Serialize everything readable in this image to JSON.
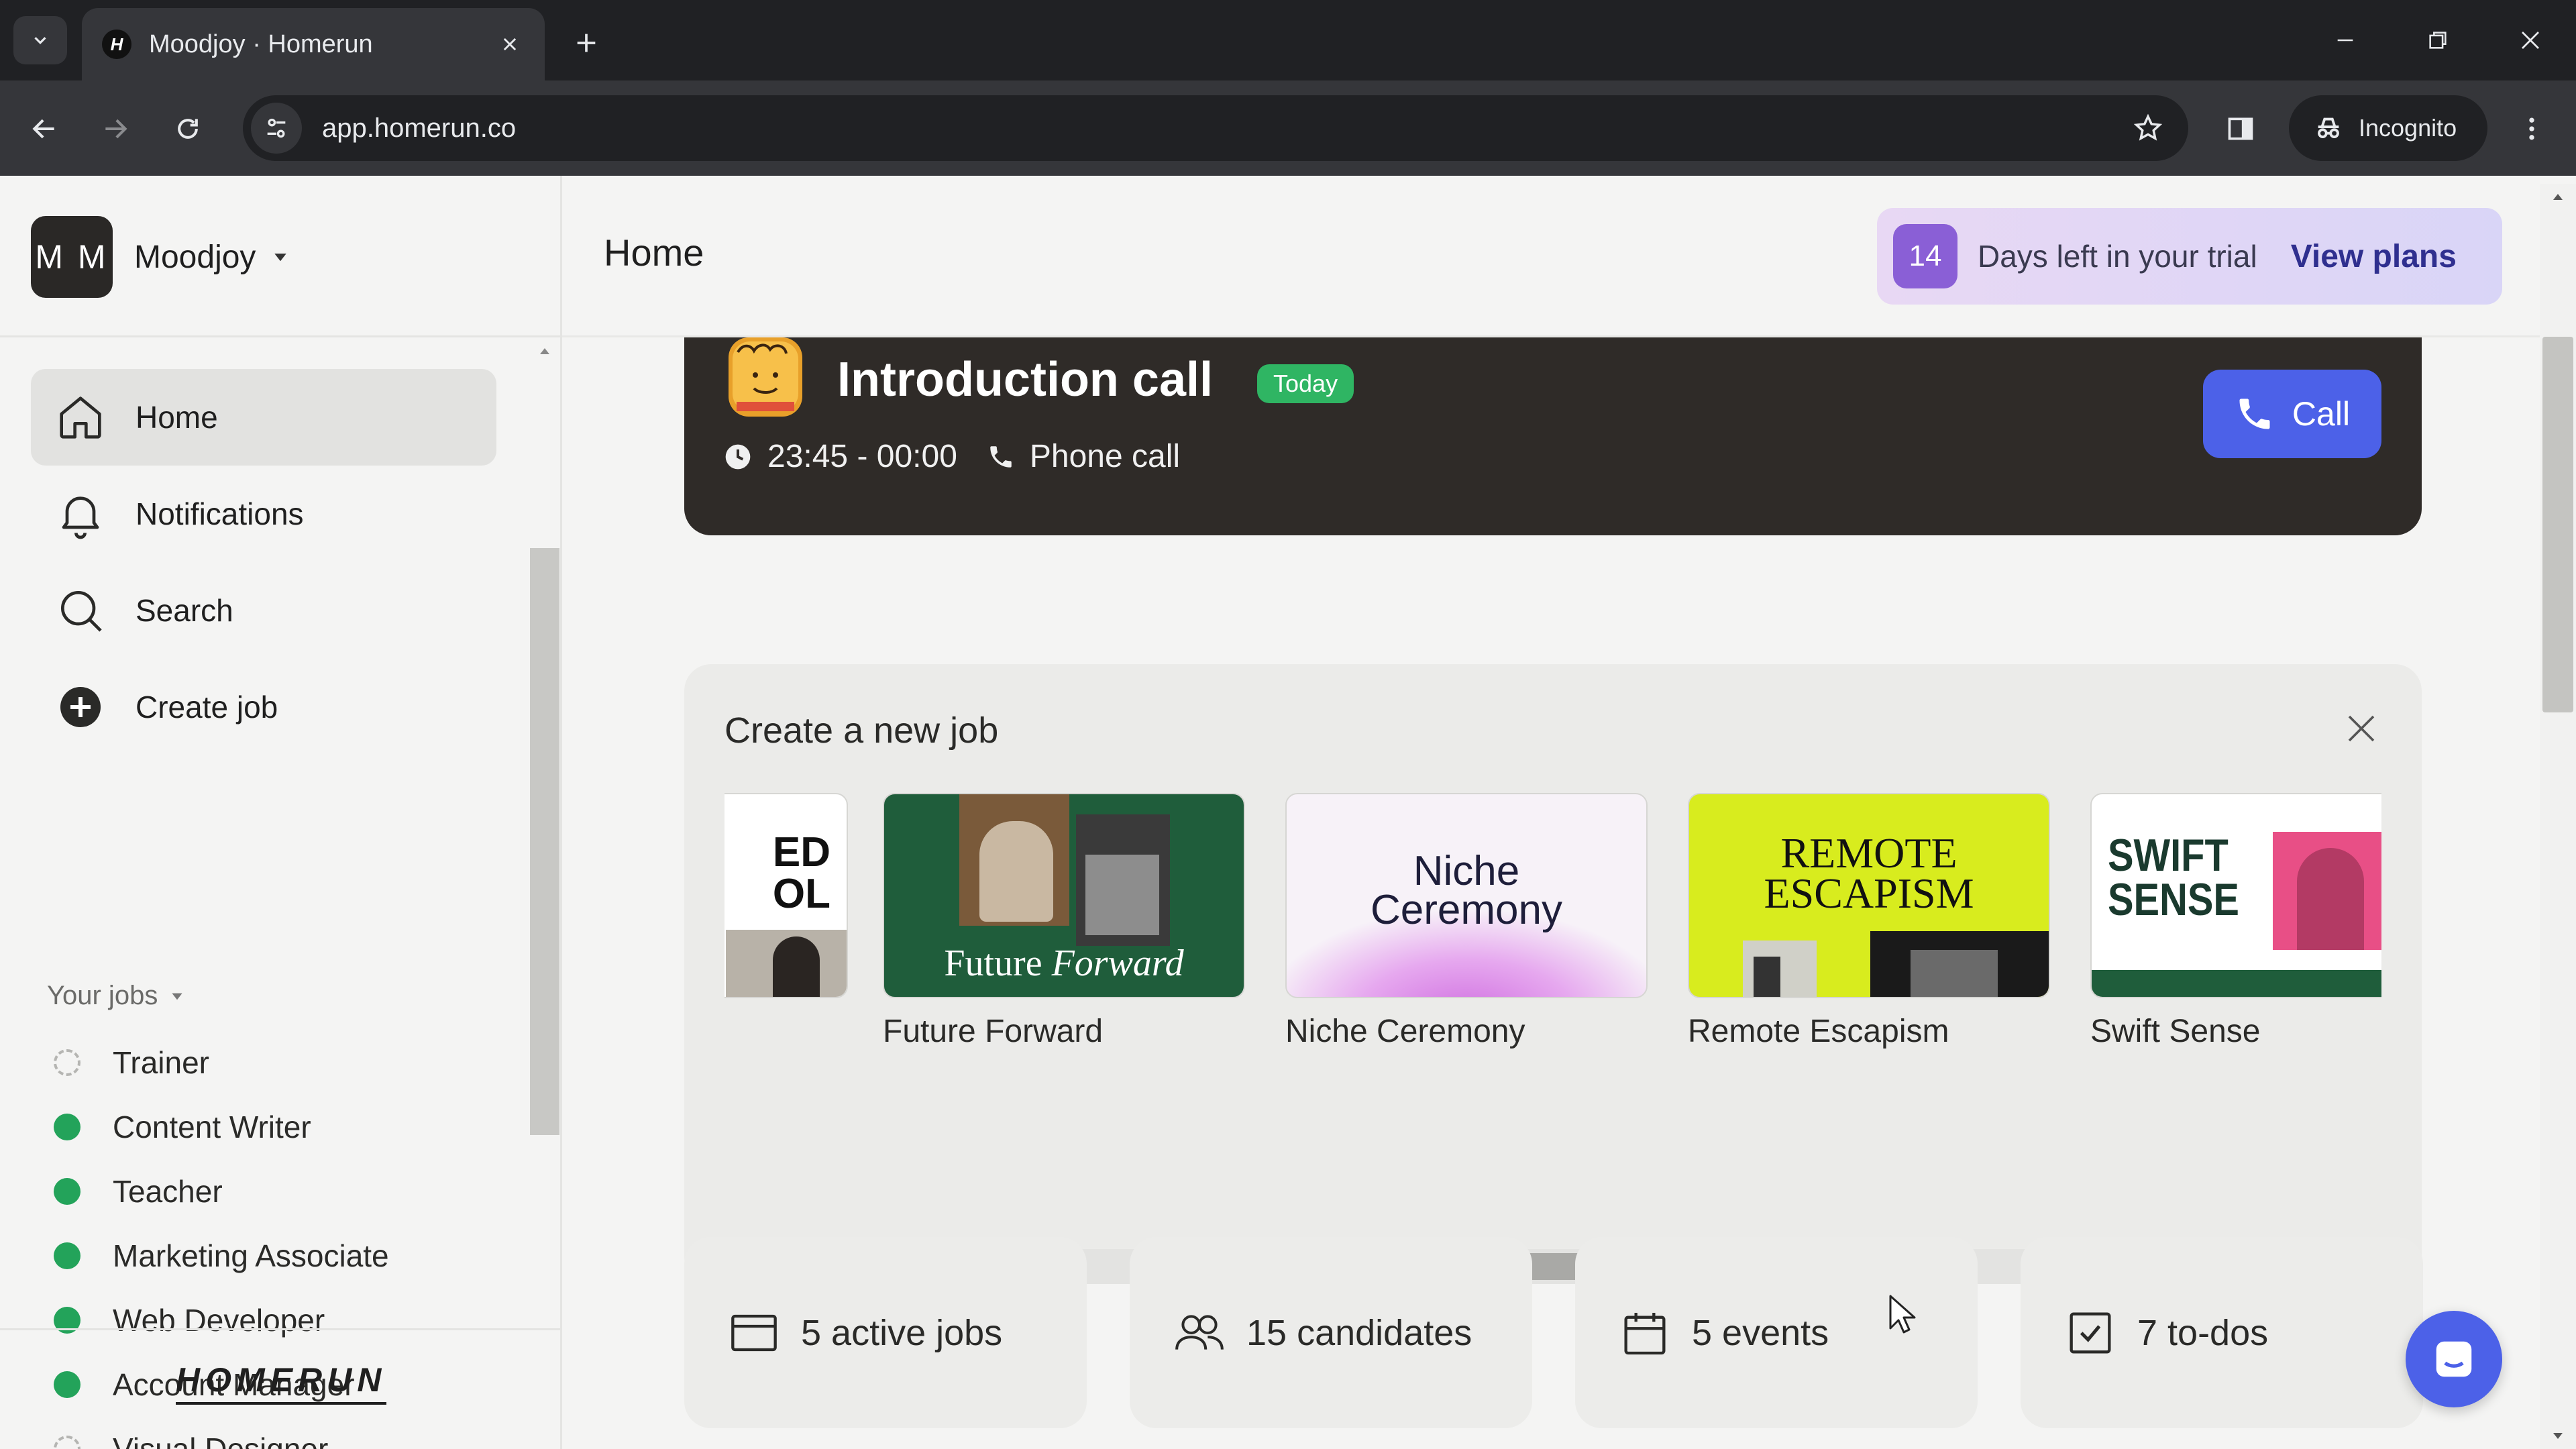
{
  "browser": {
    "tab_title": "Moodjoy · Homerun",
    "favicon_letter": "H",
    "url": "app.homerun.co",
    "incognito_label": "Incognito"
  },
  "sidebar": {
    "workspace_initials": "M M",
    "workspace_name": "Moodjoy",
    "nav": [
      {
        "label": "Home",
        "icon": "home-icon",
        "active": true
      },
      {
        "label": "Notifications",
        "icon": "bell-icon"
      },
      {
        "label": "Search",
        "icon": "search-icon"
      },
      {
        "label": "Create job",
        "icon": "plus-circle-icon"
      }
    ],
    "your_jobs_label": "Your jobs",
    "jobs": [
      {
        "label": "Trainer",
        "status": "draft"
      },
      {
        "label": "Content Writer",
        "status": "live"
      },
      {
        "label": "Teacher",
        "status": "live"
      },
      {
        "label": "Marketing Associate",
        "status": "live"
      },
      {
        "label": "Web Developer",
        "status": "live"
      },
      {
        "label": "Account Manager",
        "status": "live"
      },
      {
        "label": "Visual Designer",
        "status": "draft"
      }
    ],
    "logo_text": "HOMERUN"
  },
  "header": {
    "title": "Home",
    "trial_days": "14",
    "trial_text": "Days left in your trial",
    "trial_link": "View plans"
  },
  "event": {
    "title": "Introduction call",
    "badge": "Today",
    "time": "23:45 - 00:00",
    "type": "Phone call",
    "call_label": "Call"
  },
  "create_job": {
    "title": "Create a new job",
    "partial_tile_text": [
      "ED",
      "OL"
    ],
    "templates": [
      {
        "name": "Future Forward",
        "art_text": [
          "Future",
          "Forward"
        ]
      },
      {
        "name": "Niche Ceremony",
        "art_text": [
          "Niche",
          "Ceremony"
        ]
      },
      {
        "name": "Remote Escapism",
        "art_text": [
          "REMOTE",
          "ESCAPISM"
        ]
      },
      {
        "name": "Swift Sense",
        "art_text": [
          "SWIFT",
          "SENSE"
        ]
      }
    ]
  },
  "stats": [
    {
      "label": "5 active jobs",
      "icon": "briefcase-icon"
    },
    {
      "label": "15 candidates",
      "icon": "users-icon"
    },
    {
      "label": "5 events",
      "icon": "calendar-icon"
    },
    {
      "label": "7 to-dos",
      "icon": "checkbox-icon"
    }
  ],
  "colors": {
    "accent": "#4c61e8",
    "live_status": "#23a35a",
    "event_card": "#2f2b28",
    "trial_badge": "#8a5fd6"
  }
}
